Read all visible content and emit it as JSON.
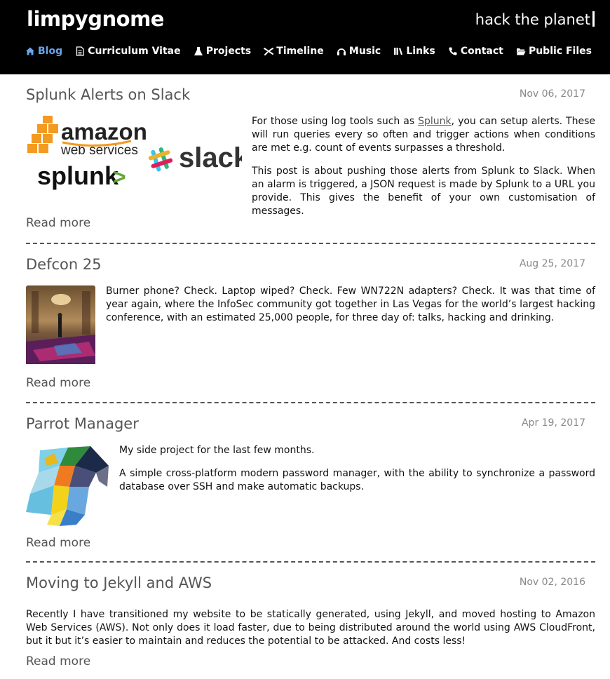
{
  "header": {
    "site_title": "limpygnome",
    "tagline": "hack the planet"
  },
  "nav": [
    {
      "label": "Blog",
      "icon": "home-icon",
      "active": true
    },
    {
      "label": "Curriculum Vitae",
      "icon": "document-icon"
    },
    {
      "label": "Projects",
      "icon": "flask-icon"
    },
    {
      "label": "Timeline",
      "icon": "plane-icon"
    },
    {
      "label": "Music",
      "icon": "headphones-icon"
    },
    {
      "label": "Links",
      "icon": "books-icon"
    },
    {
      "label": "Contact",
      "icon": "phone-icon"
    },
    {
      "label": "Public Files",
      "icon": "folder-open-icon"
    }
  ],
  "colors": {
    "active_nav": "#6aa5ea",
    "header_bg": "#000000",
    "title": "#555555",
    "date": "#888888"
  },
  "posts": [
    {
      "title": "Splunk Alerts on Slack",
      "date": "Nov 06, 2017",
      "p1_before": "For those using log tools such as ",
      "p1_link": "Splunk",
      "p1_after": ", you can setup alerts. These will run queries every so often and trigger actions when conditions are met e.g. count of events surpasses a threshold.",
      "p2": "This post is about pushing those alerts from Splunk to Slack. When an alarm is triggered, a JSON request is made by Splunk to a URL you provide. This gives the benefit of your own customisation of messages.",
      "logos": {
        "amazon": "amazon",
        "webservices": "web services",
        "splunk": "splunk",
        "splunk_mark": ">",
        "slack": "slack"
      },
      "read_more": "Read more"
    },
    {
      "title": "Defcon 25",
      "date": "Aug 25, 2017",
      "p1": "Burner phone? Check. Laptop wiped? Check. Few WN722N adapters? Check. It was that time of year again, where the InfoSec community got together in Las Vegas for the world’s largest hacking conference, with an estimated 25,000 people, for three day of: talks, hacking and drinking.",
      "read_more": "Read more"
    },
    {
      "title": "Parrot Manager",
      "date": "Apr 19, 2017",
      "p1": "My side project for the last few months.",
      "p2": "A simple cross-platform modern password manager, with the ability to synchronize a password database over SSH and make automatic backups.",
      "read_more": "Read more"
    },
    {
      "title": "Moving to Jekyll and AWS",
      "date": "Nov 02, 2016",
      "p1": "Recently I have transitioned my website to be statically generated, using Jekyll, and moved hosting to Amazon Web Services (AWS). Not only does it load faster, due to being distributed around the world using AWS CloudFront, but it but it’s easier to maintain and reduces the potential to be attacked. And costs less!",
      "read_more": "Read more"
    }
  ]
}
